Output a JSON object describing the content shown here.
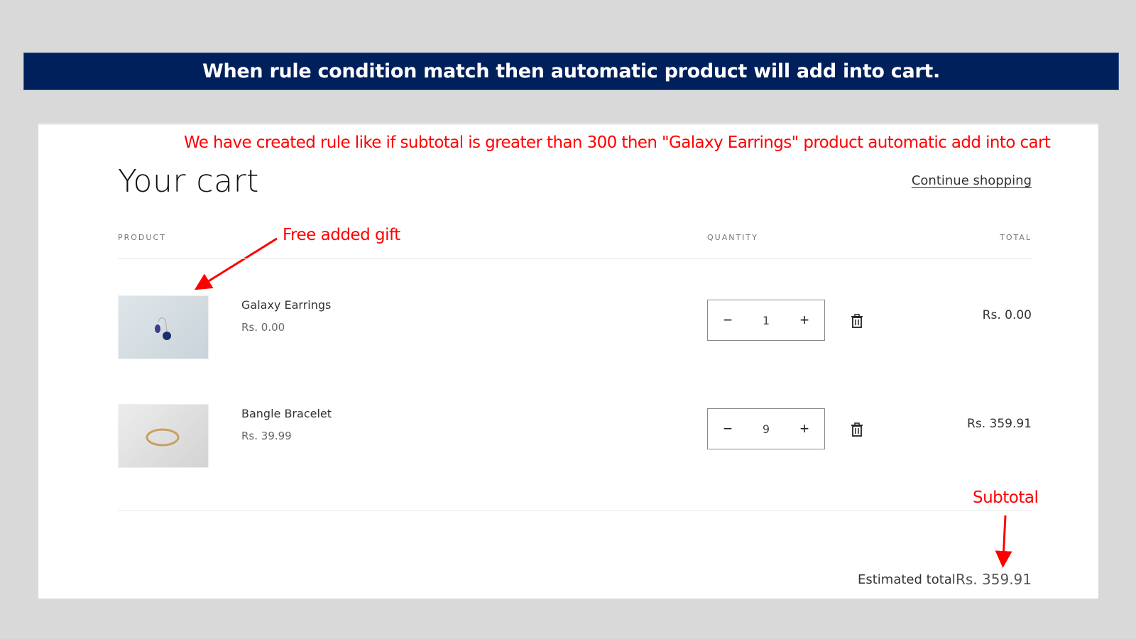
{
  "banner": {
    "text": "When rule condition match then automatic product will add into cart."
  },
  "annotations": {
    "rule_note": "We have created rule like if subtotal is greater than 300 then \"Galaxy Earrings\" product automatic add into cart",
    "free_gift": "Free added gift",
    "subtotal": "Subtotal"
  },
  "cart": {
    "title": "Your cart",
    "continue_shopping": "Continue shopping",
    "columns": {
      "product": "PRODUCT",
      "quantity": "QUANTITY",
      "total": "TOTAL"
    },
    "items": [
      {
        "name": "Galaxy Earrings",
        "price": "Rs. 0.00",
        "quantity": "1",
        "line_total": "Rs. 0.00",
        "decrement": "−",
        "increment": "+",
        "image": "earrings-image"
      },
      {
        "name": "Bangle Bracelet",
        "price": "Rs. 39.99",
        "quantity": "9",
        "line_total": "Rs. 359.91",
        "decrement": "−",
        "increment": "+",
        "image": "bracelet-image"
      }
    ],
    "estimated_total_label": "Estimated total",
    "estimated_total_value": "Rs. 359.91"
  },
  "colors": {
    "banner_bg": "#00205b",
    "annotation": "#ff0000",
    "page_bg": "#d9d9d9"
  }
}
